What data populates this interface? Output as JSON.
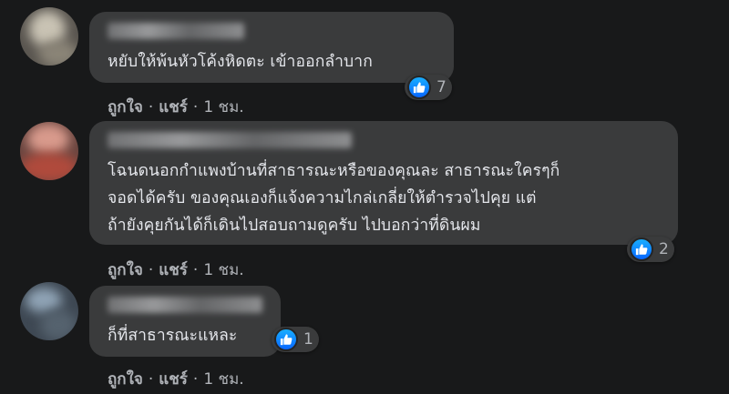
{
  "comments": [
    {
      "text_lines": [
        "หยับให้พ้นหัวโค้งหิดตะ เข้าออกลำบาก"
      ],
      "reaction_count": "7",
      "actions": {
        "like": "ถูกใจ",
        "share": "แชร์",
        "time": "1 ชม."
      }
    },
    {
      "text_lines": [
        "โฉนดนอกกำแพงบ้านที่สาธารณะหรือของคุณละ สาธารณะใครๆก็",
        "จอดได้ครับ ของคุณเองก็แจ้งความไกล่เกลี่ยให้ตำรวจไปคุย แต่",
        "ถ้ายังคุยกันได้ก็เดินไปสอบถามดูครับ ไปบอกว่าที่ดินผม"
      ],
      "reaction_count": "2",
      "actions": {
        "like": "ถูกใจ",
        "share": "แชร์",
        "time": "1 ชม."
      }
    },
    {
      "text_lines": [
        "ก็ที่สาธารณะแหละ"
      ],
      "reaction_count": "1",
      "actions": {
        "like": "ถูกใจ",
        "share": "แชร์",
        "time": "1 ชม."
      }
    }
  ],
  "colors": {
    "background": "#18191a",
    "bubble": "#3a3b3c",
    "text": "#e4e6eb",
    "secondary_text": "#b0b3b8",
    "like_blue": "#0866ff"
  },
  "icons": {
    "reaction": "like-thumbs-up-icon"
  }
}
